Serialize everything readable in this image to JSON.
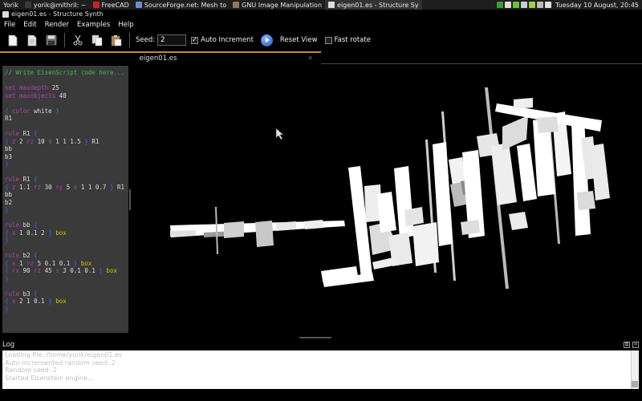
{
  "taskbar": {
    "user": "Yorik",
    "items": [
      {
        "label": "yorik@mithril: ~",
        "icon": "terminal-icon",
        "color": "#3a3a3a"
      },
      {
        "label": "FreeCAD",
        "icon": "freecad-icon",
        "color": "#cc2222"
      },
      {
        "label": "SourceForge.net: Mesh to",
        "icon": "browser-icon",
        "color": "#6a8fd0"
      },
      {
        "label": "GNU Image Manipulation",
        "icon": "gimp-icon",
        "color": "#8a7a5a"
      },
      {
        "label": "eigen01.es - Structure Sy",
        "icon": "structuresynth-icon",
        "color": "#dddddd"
      }
    ],
    "tray_icons": [
      "update-icon",
      "network-icon",
      "chat-icon",
      "volume-icon",
      "power-icon",
      "keyboard-icon",
      "clipboard-icon"
    ],
    "clock": "Tuesday 10 August, 20:45"
  },
  "window": {
    "title": "eigen01.es - Structure Synth"
  },
  "menu": [
    "File",
    "Edit",
    "Render",
    "Examples",
    "Help"
  ],
  "toolbar": {
    "seed_label": "Seed:",
    "seed_value": "2",
    "auto_increment_label": "Auto Increment",
    "auto_increment_checked": true,
    "reset_view_label": "Reset View",
    "fast_rotate_label": "Fast rotate",
    "fast_rotate_checked": false
  },
  "editor": {
    "tab_label": "eigen01.es",
    "lines": [
      [
        {
          "t": "// Write EisenScript code here...",
          "c": "c-comment"
        }
      ],
      [],
      [
        {
          "t": "set maxdepth ",
          "c": "c-kw"
        },
        {
          "t": "25",
          "c": "c-txt"
        }
      ],
      [
        {
          "t": "set maxobjects ",
          "c": "c-kw"
        },
        {
          "t": "40",
          "c": "c-txt"
        }
      ],
      [],
      [
        {
          "t": "{ ",
          "c": "c-br"
        },
        {
          "t": "color ",
          "c": "c-kw"
        },
        {
          "t": "white ",
          "c": "c-txt"
        },
        {
          "t": "}",
          "c": "c-br"
        }
      ],
      [
        {
          "t": "R1",
          "c": "c-txt"
        }
      ],
      [],
      [
        {
          "t": "rule ",
          "c": "c-kw"
        },
        {
          "t": "R1 ",
          "c": "c-txt"
        },
        {
          "t": "{",
          "c": "c-br"
        }
      ],
      [
        {
          "t": "{ ",
          "c": "c-br"
        },
        {
          "t": "z ",
          "c": "c-kw"
        },
        {
          "t": "2 ",
          "c": "c-txt"
        },
        {
          "t": "rz ",
          "c": "c-kw"
        },
        {
          "t": "10 ",
          "c": "c-txt"
        },
        {
          "t": "s ",
          "c": "c-kw"
        },
        {
          "t": "1 1 1.5 ",
          "c": "c-txt"
        },
        {
          "t": "} ",
          "c": "c-br"
        },
        {
          "t": "R1",
          "c": "c-txt"
        }
      ],
      [
        {
          "t": "bb",
          "c": "c-txt"
        }
      ],
      [
        {
          "t": "b3",
          "c": "c-txt"
        }
      ],
      [
        {
          "t": "}",
          "c": "c-br"
        }
      ],
      [],
      [
        {
          "t": "rule ",
          "c": "c-kw"
        },
        {
          "t": "R1 ",
          "c": "c-txt"
        },
        {
          "t": "{",
          "c": "c-br"
        }
      ],
      [
        {
          "t": "{ ",
          "c": "c-br"
        },
        {
          "t": "z ",
          "c": "c-kw"
        },
        {
          "t": "1.1 ",
          "c": "c-txt"
        },
        {
          "t": "rz ",
          "c": "c-kw"
        },
        {
          "t": "30 ",
          "c": "c-txt"
        },
        {
          "t": "ry ",
          "c": "c-kw"
        },
        {
          "t": "5 ",
          "c": "c-txt"
        },
        {
          "t": "s ",
          "c": "c-kw"
        },
        {
          "t": "1 1 0.7 ",
          "c": "c-txt"
        },
        {
          "t": "} ",
          "c": "c-br"
        },
        {
          "t": "R1",
          "c": "c-txt"
        }
      ],
      [
        {
          "t": "bb",
          "c": "c-txt"
        }
      ],
      [
        {
          "t": "b2",
          "c": "c-txt"
        }
      ],
      [
        {
          "t": "}",
          "c": "c-br"
        }
      ],
      [],
      [
        {
          "t": "rule ",
          "c": "c-kw"
        },
        {
          "t": "bb ",
          "c": "c-txt"
        },
        {
          "t": "{",
          "c": "c-br"
        }
      ],
      [
        {
          "t": "{ ",
          "c": "c-br"
        },
        {
          "t": "s ",
          "c": "c-kw"
        },
        {
          "t": "1 0.1 2 ",
          "c": "c-txt"
        },
        {
          "t": "} ",
          "c": "c-br"
        },
        {
          "t": "box",
          "c": "c-prim"
        }
      ],
      [
        {
          "t": "}",
          "c": "c-br"
        }
      ],
      [],
      [
        {
          "t": "rule ",
          "c": "c-kw"
        },
        {
          "t": "b2 ",
          "c": "c-txt"
        },
        {
          "t": "{",
          "c": "c-br"
        }
      ],
      [
        {
          "t": "{ ",
          "c": "c-br"
        },
        {
          "t": "s ",
          "c": "c-kw"
        },
        {
          "t": "1 ",
          "c": "c-txt"
        },
        {
          "t": "rz ",
          "c": "c-kw"
        },
        {
          "t": "5 0.1 0.1 ",
          "c": "c-txt"
        },
        {
          "t": "} ",
          "c": "c-br"
        },
        {
          "t": "box",
          "c": "c-prim"
        }
      ],
      [
        {
          "t": "{ ",
          "c": "c-br"
        },
        {
          "t": "rx ",
          "c": "c-kw"
        },
        {
          "t": "90 ",
          "c": "c-txt"
        },
        {
          "t": "rz ",
          "c": "c-kw"
        },
        {
          "t": "45 ",
          "c": "c-txt"
        },
        {
          "t": "s ",
          "c": "c-kw"
        },
        {
          "t": "3 0.1 0.1 ",
          "c": "c-txt"
        },
        {
          "t": "} ",
          "c": "c-br"
        },
        {
          "t": "box",
          "c": "c-prim"
        }
      ],
      [
        {
          "t": "}",
          "c": "c-br"
        }
      ],
      [],
      [
        {
          "t": "rule ",
          "c": "c-kw"
        },
        {
          "t": "b3 ",
          "c": "c-txt"
        },
        {
          "t": "{",
          "c": "c-br"
        }
      ],
      [
        {
          "t": "{ ",
          "c": "c-br"
        },
        {
          "t": "s ",
          "c": "c-kw"
        },
        {
          "t": "2 1 0.1 ",
          "c": "c-txt"
        },
        {
          "t": "} ",
          "c": "c-br"
        },
        {
          "t": "box",
          "c": "c-prim"
        }
      ],
      [
        {
          "t": "}",
          "c": "c-br"
        }
      ]
    ]
  },
  "log": {
    "title": "Log",
    "lines": [
      "Loading file: /home/yorik/eigen01.es",
      "Auto-incremented random seed: 2",
      "Random seed: 2",
      "Started Eisenstein engine..."
    ]
  }
}
